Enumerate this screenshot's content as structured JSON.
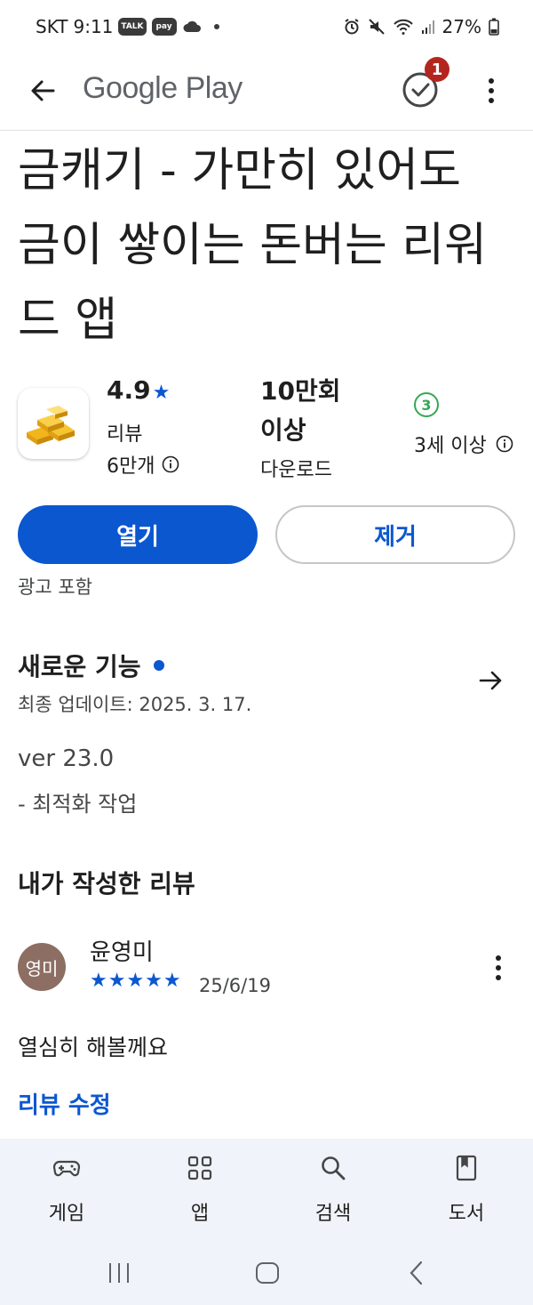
{
  "status_bar": {
    "carrier": "SKT",
    "time": "9:11",
    "chips": [
      "TALK",
      "pay"
    ],
    "battery": "27%"
  },
  "app_bar": {
    "brand": "Google Play",
    "notification_count": "1"
  },
  "app": {
    "title": "금캐기 - 가만히 있어도 금이 쌓이는 돈버는 리워드 앱",
    "rating": "4.9",
    "rating_star": "★",
    "review_label": "리뷰",
    "review_count": "6만개",
    "downloads": "10만회 이상",
    "downloads_label": "다운로드",
    "age_rating": "3",
    "age_label": "3세 이상"
  },
  "actions": {
    "open_label": "열기",
    "remove_label": "제거",
    "ads_note": "광고 포함"
  },
  "whats_new": {
    "title": "새로운 기능",
    "last_updated": "최종 업데이트: 2025. 3. 17.",
    "version": "ver 23.0",
    "changes": "- 최적화 작업"
  },
  "my_review": {
    "section_title": "내가 작성한 리뷰",
    "avatar_text": "영미",
    "reviewer_name": "윤영미",
    "stars": 5,
    "stars_text": "★★★★★",
    "date": "25/6/19",
    "text": "열심히 해볼께요",
    "edit_label": "리뷰 수정"
  },
  "bottom_nav": {
    "items": [
      {
        "label": "게임",
        "icon": "gamepad-icon"
      },
      {
        "label": "앱",
        "icon": "apps-grid-icon"
      },
      {
        "label": "검색",
        "icon": "search-icon"
      },
      {
        "label": "도서",
        "icon": "book-icon"
      }
    ]
  },
  "colors": {
    "accent": "#0b57d0",
    "badge": "#b3261e",
    "age_green": "#34a853",
    "avatar": "#8d6e63"
  }
}
